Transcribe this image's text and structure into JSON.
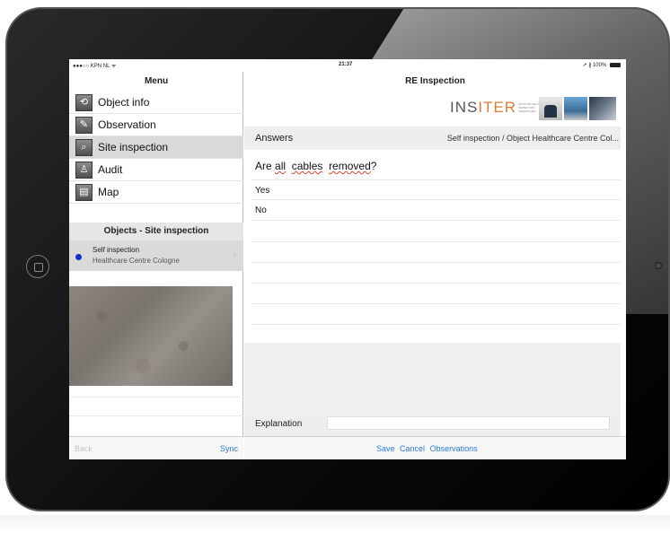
{
  "status_bar": {
    "carrier": "●●●○○ KPN NL ᯤ",
    "time": "21:37",
    "battery": "➚ ∦ 100%"
  },
  "menu": {
    "title": "Menu",
    "items": [
      {
        "label": "Object info",
        "icon": "object-info-icon"
      },
      {
        "label": "Observation",
        "icon": "pencil-icon"
      },
      {
        "label": "Site inspection",
        "icon": "magnifier-icon",
        "selected": true
      },
      {
        "label": "Audit",
        "icon": "audit-icon"
      },
      {
        "label": "Map",
        "icon": "map-icon"
      }
    ]
  },
  "objects": {
    "header": "Objects - Site inspection",
    "item": {
      "title": "Self inspection",
      "subtitle": "Healthcare Centre Cologne",
      "status_color": "#1230c8"
    }
  },
  "left_toolbar": {
    "back_label": "Back",
    "sync_label": "Sync"
  },
  "detail": {
    "title": "RE Inspection",
    "logo_text_1": "INSITER",
    "logo_sub": "INTUITIVE SELF-INSPECTION TECHNIQUES",
    "answers_label": "Answers",
    "breadcrumb": "Self inspection / Object Healthcare Centre Col...",
    "question": {
      "prefix": "Are ",
      "w1": "all",
      "w2": "cables",
      "w3": "removed",
      "suffix": "?"
    },
    "answers": [
      "Yes",
      "No"
    ],
    "explanation_label": "Explanation",
    "explanation_value": ""
  },
  "detail_toolbar": {
    "save_label": "Save",
    "cancel_label": "Cancel",
    "observations_label": "Observations"
  },
  "colors": {
    "accent": "#2a7be0",
    "logo_orange": "#e07a33",
    "selected_row": "#d9d9d9"
  }
}
